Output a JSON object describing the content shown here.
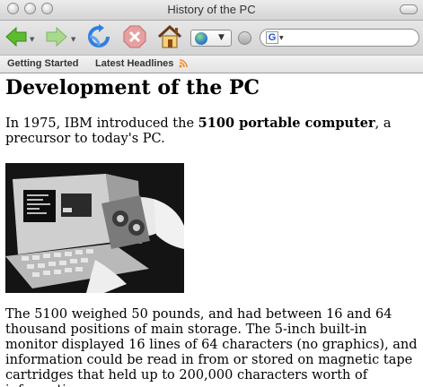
{
  "window": {
    "title": "History of the PC"
  },
  "toolbar": {
    "back_icon": "back-arrow-icon",
    "forward_icon": "forward-arrow-icon",
    "reload_icon": "reload-icon",
    "stop_icon": "stop-icon",
    "home_icon": "home-icon",
    "search_engine_icon": "google-icon"
  },
  "bookmarks": {
    "items": [
      {
        "label": "Getting Started"
      },
      {
        "label": "Latest Headlines"
      }
    ]
  },
  "content": {
    "heading": "Development of the PC",
    "p1_before": "In 1975, IBM introduced the ",
    "p1_bold": "5100 portable computer",
    "p1_after": ", a precursor to today's PC.",
    "p2": "The 5100 weighed 50 pounds, and had between 16 and 64 thousand positions of main storage. The 5-inch built-in monitor displayed 16 lines of 64 characters (no graphics), and information could be read in from or stored on magnetic tape cartridges that held up to 200,000 characters worth of information."
  },
  "colors": {
    "link_rss": "#f08a24",
    "reload": "#2f7fe0",
    "stop": "#d96a6a",
    "nav_arrow": "#5dbb2f"
  }
}
